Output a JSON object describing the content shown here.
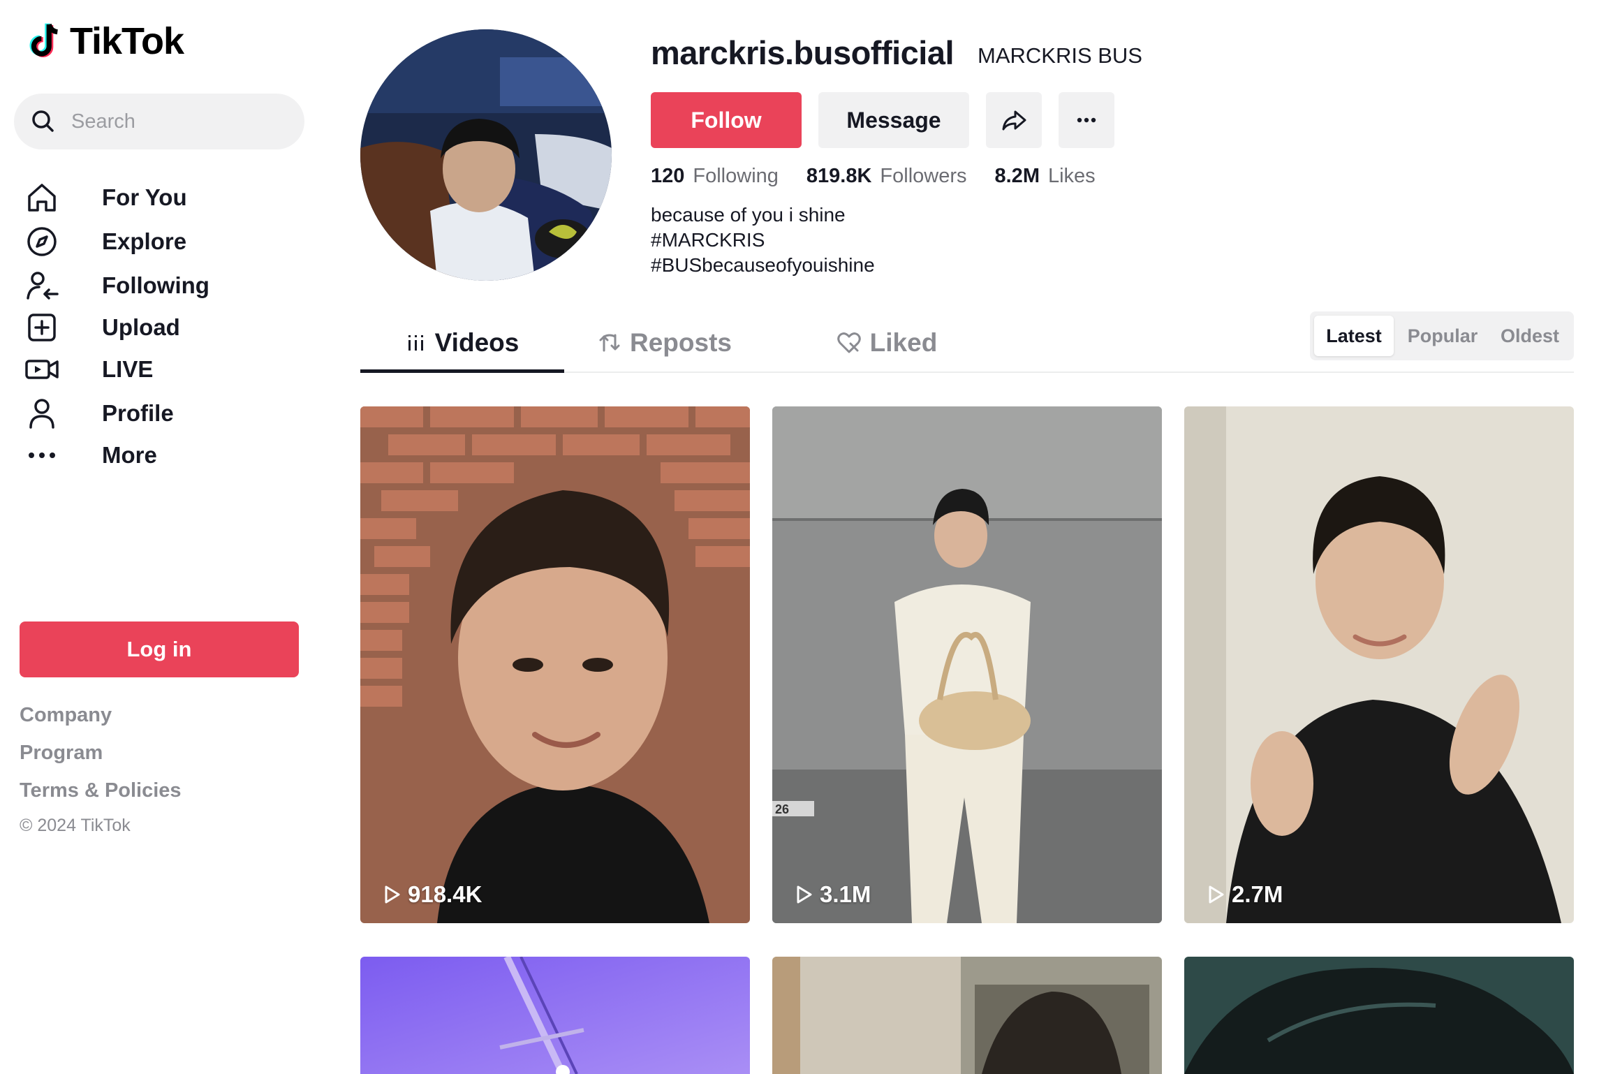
{
  "app": {
    "name": "TikTok"
  },
  "search": {
    "placeholder": "Search"
  },
  "sidebar": {
    "items": [
      {
        "label": "For You",
        "icon": "home-icon"
      },
      {
        "label": "Explore",
        "icon": "compass-icon"
      },
      {
        "label": "Following",
        "icon": "following-users-icon"
      },
      {
        "label": "Upload",
        "icon": "plus-square-icon"
      },
      {
        "label": "LIVE",
        "icon": "live-camera-icon"
      },
      {
        "label": "Profile",
        "icon": "person-icon"
      },
      {
        "label": "More",
        "icon": "more-dots-icon"
      }
    ],
    "login_label": "Log in",
    "footer_links": [
      "Company",
      "Program",
      "Terms & Policies"
    ],
    "copyright": "© 2024 TikTok"
  },
  "profile": {
    "username": "marckris.busofficial",
    "nickname": "MARCKRIS BUS",
    "follow_label": "Follow",
    "message_label": "Message",
    "stats": [
      {
        "value": "120",
        "label": "Following"
      },
      {
        "value": "819.8K",
        "label": "Followers"
      },
      {
        "value": "8.2M",
        "label": "Likes"
      }
    ],
    "bio": [
      "because of you i shine",
      "#MARCKRIS",
      "#BUSbecauseofyouishine"
    ]
  },
  "tabs": [
    {
      "label": "Videos",
      "icon": "grid-icon",
      "active": true
    },
    {
      "label": "Reposts",
      "icon": "repost-icon",
      "active": false
    },
    {
      "label": "Liked",
      "icon": "liked-heart-icon",
      "active": false
    }
  ],
  "sort": {
    "options": [
      "Latest",
      "Popular",
      "Oldest"
    ],
    "selected": "Latest"
  },
  "videos": [
    {
      "views": "918.4K"
    },
    {
      "views": "3.1M"
    },
    {
      "views": "2.7M"
    },
    {
      "views": ""
    },
    {
      "views": ""
    },
    {
      "views": ""
    }
  ],
  "colors": {
    "accent": "#ea4359",
    "text": "#161823",
    "muted": "#8a8b91",
    "surface": "#f1f1f2"
  }
}
